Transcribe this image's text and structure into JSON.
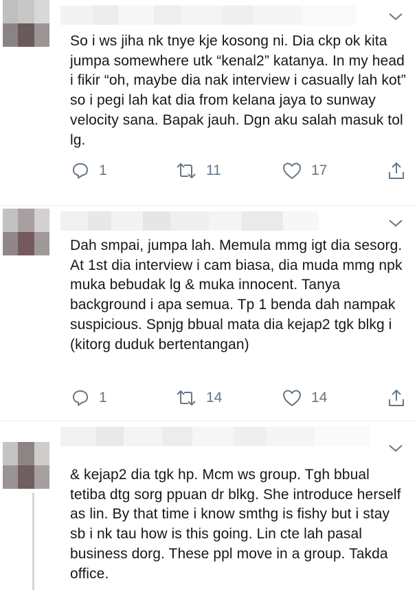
{
  "tweets": [
    {
      "text": "So i ws jiha nk tnye kje kosong ni. Dia ckp ok kita jumpa somewhere utk “kenal2” katanya. In my head i fikir “oh, maybe dia nak interview i casually lah kot” so i pegi lah kat dia from kelana jaya to sunway velocity sana. Bapak jauh. Dgn aku salah masuk tol lg.",
      "replies": "1",
      "retweets": "11",
      "likes": "17"
    },
    {
      "text": "Dah smpai, jumpa lah. Memula mmg igt dia sesorg. At 1st dia interview i cam biasa, dia muda mmg npk muka bebudak lg & muka innocent. Tanya background i apa semua. Tp 1 benda dah nampak suspicious. Spnjg bbual mata dia kejap2 tgk blkg i (kitorg duduk bertentangan)",
      "replies": "1",
      "retweets": "14",
      "likes": "14"
    },
    {
      "text": "& kejap2 dia tgk hp. Mcm ws group. Tgh bbual tetiba dtg sorg ppuan dr blkg. She introduce herself as lin. By that time i know smthg is fishy but i stay sb i nk tau how is this going. Lin cte lah pasal business dorg. These ppl move in a group. Takda office."
    }
  ],
  "icons": {
    "reply": "reply-icon",
    "retweet": "retweet-icon",
    "like": "heart-icon",
    "share": "share-icon",
    "menu": "chevron-down-icon"
  },
  "colors": {
    "text": "#14171a",
    "muted": "#657786",
    "divider": "#e6ecf0"
  }
}
